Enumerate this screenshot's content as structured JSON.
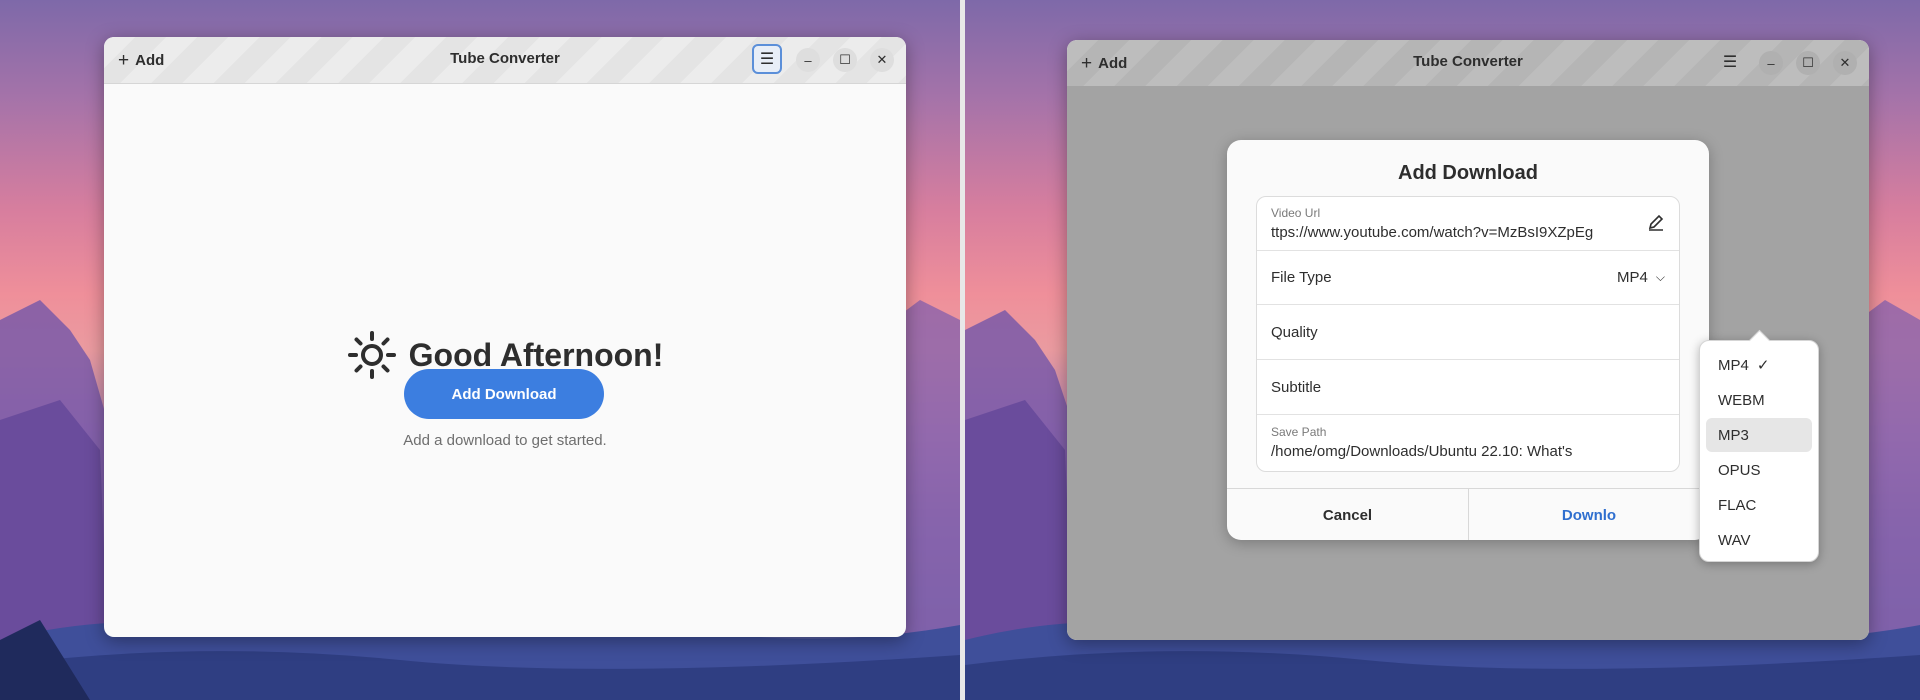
{
  "colors": {
    "accent": "#3c7ee0",
    "dialog_accent": "#2f6fcf"
  },
  "left_window": {
    "add_label": "Add",
    "title": "Tube Converter",
    "greeting": "Good Afternoon!",
    "add_download_button": "Add Download",
    "hint": "Add a download to get started."
  },
  "right_window": {
    "add_label": "Add",
    "title": "Tube Converter",
    "dialog": {
      "title": "Add Download",
      "video_url_caption": "Video Url",
      "video_url_value": "ttps://www.youtube.com/watch?v=MzBsI9XZpEg",
      "file_type_label": "File Type",
      "file_type_value": "MP4",
      "quality_label": "Quality",
      "subtitle_label": "Subtitle",
      "save_path_caption": "Save Path",
      "save_path_value": "/home/omg/Downloads/Ubuntu 22.10: What's",
      "cancel_label": "Cancel",
      "download_label": "Downlo"
    },
    "file_type_menu": {
      "options": [
        "MP4",
        "WEBM",
        "MP3",
        "OPUS",
        "FLAC",
        "WAV"
      ],
      "selected": "MP4",
      "hovered": "MP3"
    }
  }
}
